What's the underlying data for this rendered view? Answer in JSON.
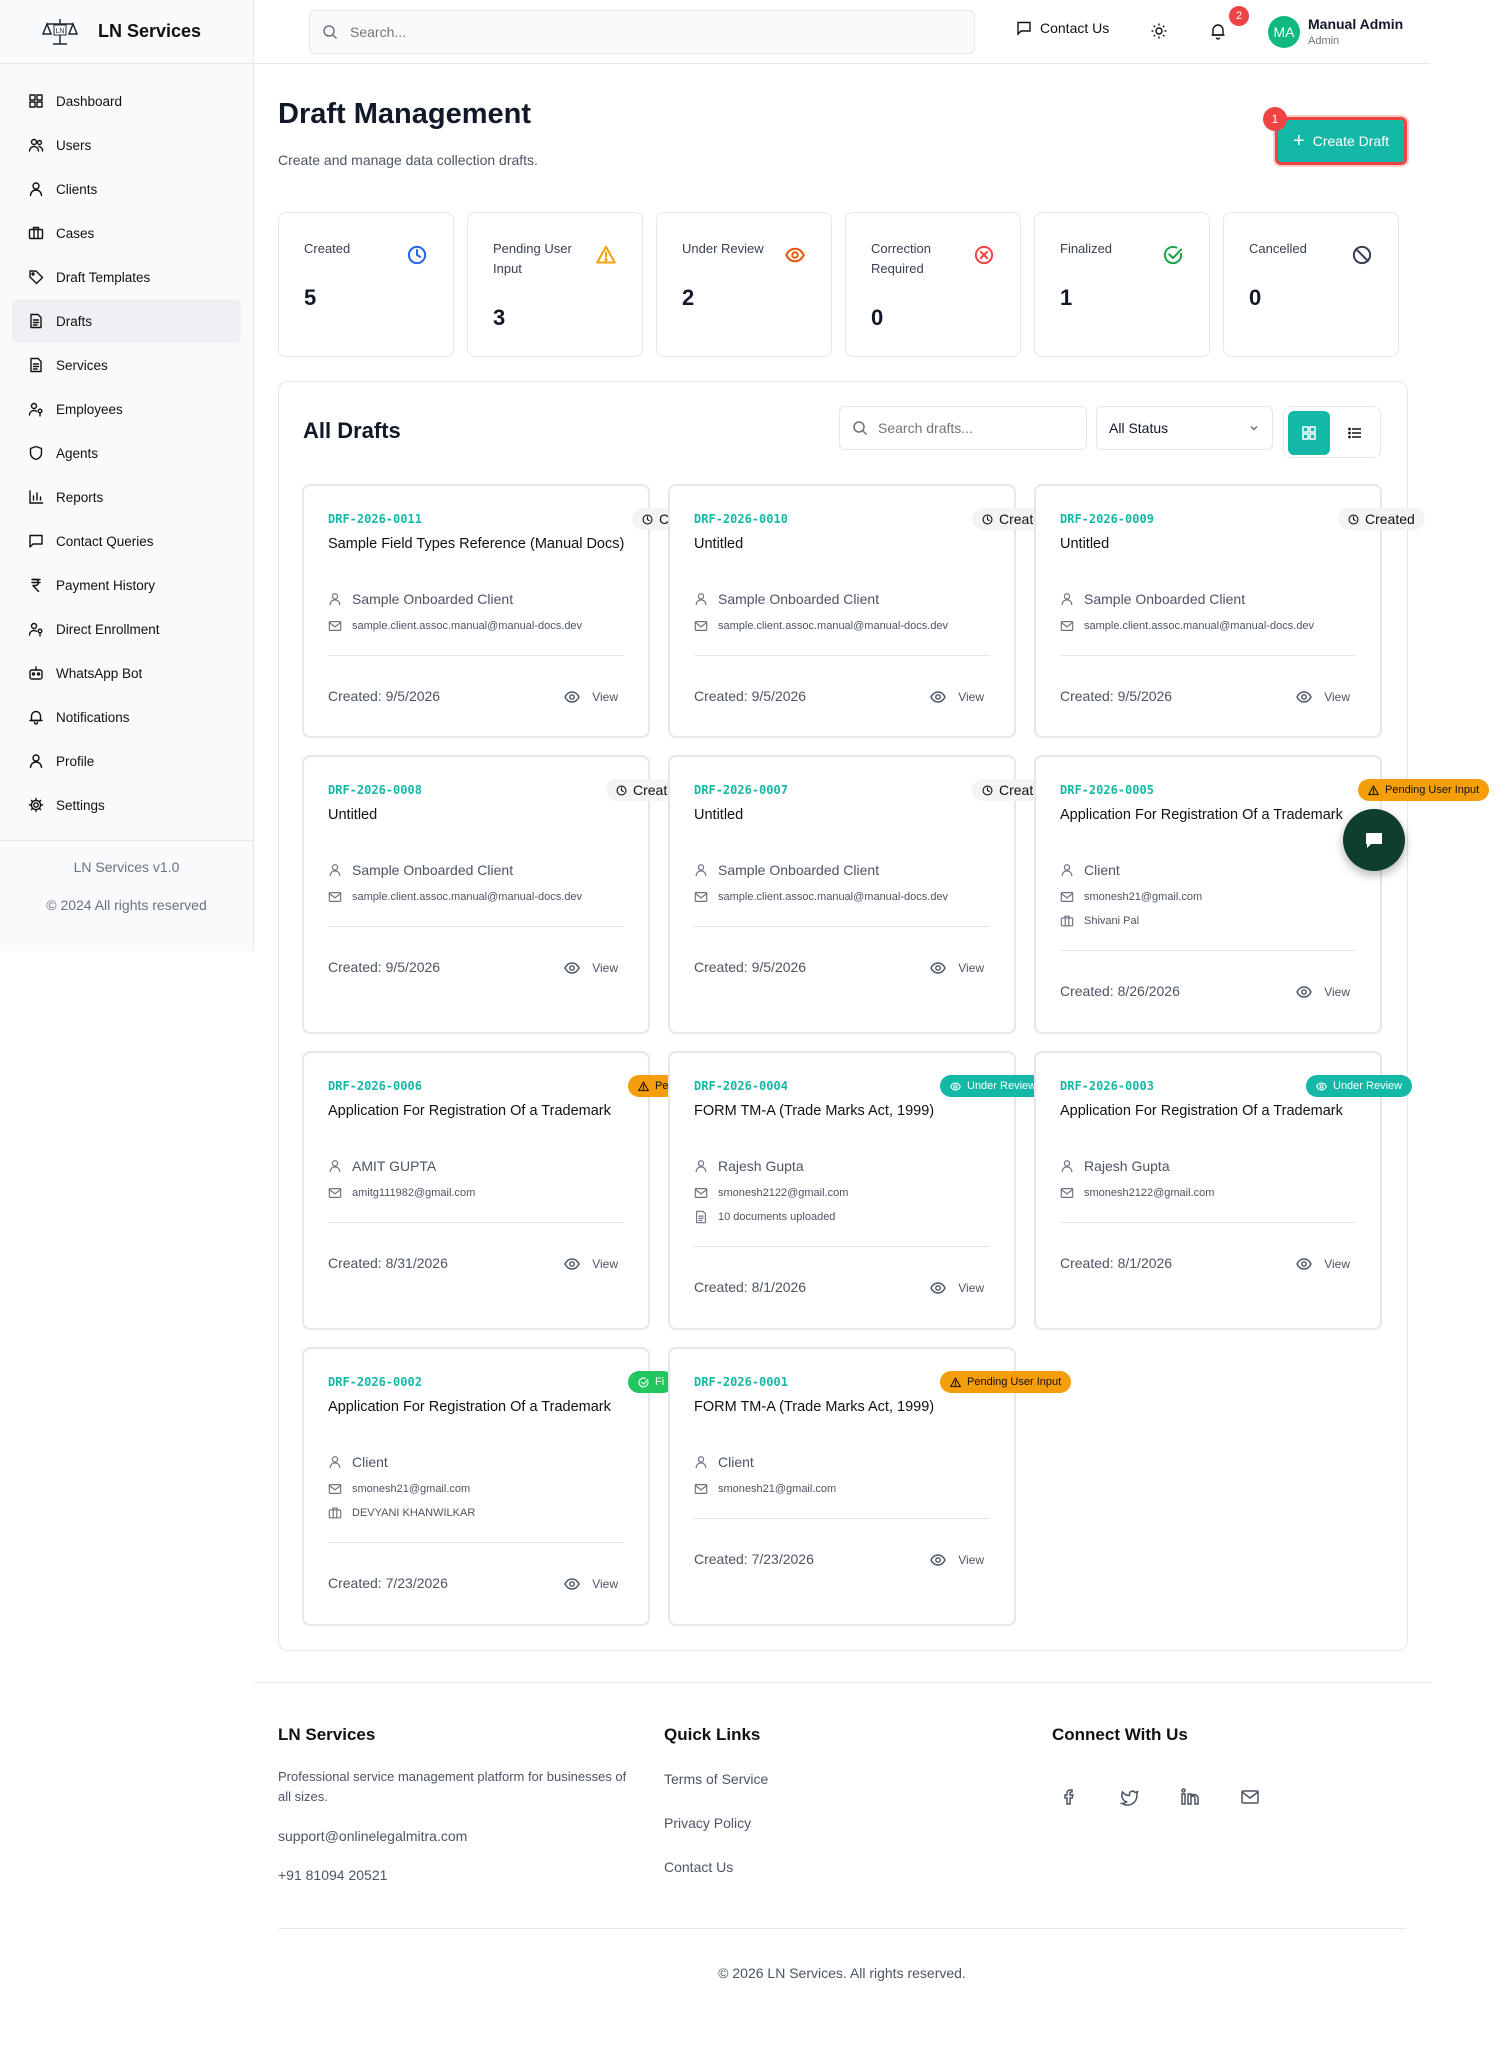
{
  "brand": {
    "name": "LN Services",
    "logo_text": "LN"
  },
  "sidebar": {
    "items": [
      {
        "label": "Dashboard",
        "icon": "dashboard-icon"
      },
      {
        "label": "Users",
        "icon": "users-icon"
      },
      {
        "label": "Clients",
        "icon": "user-icon"
      },
      {
        "label": "Cases",
        "icon": "briefcase-icon"
      },
      {
        "label": "Draft Templates",
        "icon": "tag-icon"
      },
      {
        "label": "Drafts",
        "icon": "file-icon",
        "active": true
      },
      {
        "label": "Services",
        "icon": "file-icon"
      },
      {
        "label": "Employees",
        "icon": "user-key-icon"
      },
      {
        "label": "Agents",
        "icon": "shield-icon"
      },
      {
        "label": "Reports",
        "icon": "chart-icon"
      },
      {
        "label": "Contact Queries",
        "icon": "message-icon"
      },
      {
        "label": "Payment History",
        "icon": "rupee-icon"
      },
      {
        "label": "Direct Enrollment",
        "icon": "user-key-icon"
      },
      {
        "label": "WhatsApp Bot",
        "icon": "bot-icon"
      },
      {
        "label": "Notifications",
        "icon": "bell-icon"
      },
      {
        "label": "Profile",
        "icon": "user-icon"
      },
      {
        "label": "Settings",
        "icon": "gear-icon"
      }
    ],
    "version": "LN Services v1.0",
    "rights": "© 2024 All rights reserved"
  },
  "header": {
    "search_placeholder": "Search...",
    "contact_label": "Contact Us",
    "notification_count": "2",
    "avatar_initials": "MA",
    "user_name": "Manual Admin",
    "user_role": "Admin"
  },
  "page": {
    "title": "Draft Management",
    "subtitle": "Create and manage data collection drafts.",
    "create_label": "Create Draft",
    "create_badge": "1"
  },
  "stats": [
    {
      "label": "Created",
      "value": "5",
      "icon": "clock-icon",
      "color": "#2563eb"
    },
    {
      "label": "Pending User Input",
      "value": "3",
      "icon": "warning-icon",
      "color": "#f59e0b"
    },
    {
      "label": "Under Review",
      "value": "2",
      "icon": "eye-icon",
      "color": "#ea580c"
    },
    {
      "label": "Correction Required",
      "value": "0",
      "icon": "x-circle-icon",
      "color": "#ef4444"
    },
    {
      "label": "Finalized",
      "value": "1",
      "icon": "check-circle-icon",
      "color": "#16a34a"
    },
    {
      "label": "Cancelled",
      "value": "0",
      "icon": "ban-icon",
      "color": "#374151"
    }
  ],
  "drafts_panel": {
    "title": "All Drafts",
    "search_placeholder": "Search drafts...",
    "status_filter": "All Status"
  },
  "drafts": [
    {
      "id": "DRF-2026-0011",
      "title": "Sample Field Types Reference (Manual Docs)",
      "status": "Created",
      "status_type": "created",
      "client": "Sample Onboarded Client",
      "email": "sample.client.assoc.manual@manual-docs.dev",
      "created": "Created: 9/5/2026",
      "view": "View"
    },
    {
      "id": "DRF-2026-0010",
      "title": "Untitled",
      "status": "Created",
      "status_type": "created",
      "client": "Sample Onboarded Client",
      "email": "sample.client.assoc.manual@manual-docs.dev",
      "created": "Created: 9/5/2026",
      "view": "View"
    },
    {
      "id": "DRF-2026-0009",
      "title": "Untitled",
      "status": "Created",
      "status_type": "created",
      "client": "Sample Onboarded Client",
      "email": "sample.client.assoc.manual@manual-docs.dev",
      "created": "Created: 9/5/2026",
      "view": "View"
    },
    {
      "id": "DRF-2026-0008",
      "title": "Untitled",
      "status": "Created",
      "status_type": "created",
      "client": "Sample Onboarded Client",
      "email": "sample.client.assoc.manual@manual-docs.dev",
      "created": "Created: 9/5/2026",
      "view": "View"
    },
    {
      "id": "DRF-2026-0007",
      "title": "Untitled",
      "status": "Created",
      "status_type": "created",
      "client": "Sample Onboarded Client",
      "email": "sample.client.assoc.manual@manual-docs.dev",
      "created": "Created: 9/5/2026",
      "view": "View"
    },
    {
      "id": "DRF-2026-0005",
      "title": "Application For Registration Of a Trademark",
      "status": "Pending User Input",
      "status_type": "pending",
      "client": "Client",
      "email": "smonesh21@gmail.com",
      "extra": "Shivani Pal",
      "extra_icon": "briefcase-icon",
      "created": "Created: 8/26/2026",
      "view": "View"
    },
    {
      "id": "DRF-2026-0006",
      "title": "Application For Registration Of a Trademark",
      "status": "Pe",
      "status_type": "pending",
      "client": "AMIT GUPTA",
      "email": "amitg111982@gmail.com",
      "created": "Created: 8/31/2026",
      "view": "View"
    },
    {
      "id": "DRF-2026-0004",
      "title": "FORM TM-A (Trade Marks Act, 1999)",
      "status": "Under Review",
      "status_type": "review",
      "client": "Rajesh Gupta",
      "email": "smonesh2122@gmail.com",
      "extra": "10 documents uploaded",
      "extra_icon": "document-icon",
      "created": "Created: 8/1/2026",
      "view": "View"
    },
    {
      "id": "DRF-2026-0003",
      "title": "Application For Registration Of a Trademark",
      "status": "Under Review",
      "status_type": "review",
      "client": "Rajesh Gupta",
      "email": "smonesh2122@gmail.com",
      "created": "Created: 8/1/2026",
      "view": "View"
    },
    {
      "id": "DRF-2026-0002",
      "title": "Application For Registration Of a Trademark",
      "status": "Fi",
      "status_type": "final",
      "client": "Client",
      "email": "smonesh21@gmail.com",
      "extra": "DEVYANI KHANWILKAR",
      "extra_icon": "briefcase-icon",
      "created": "Created: 7/23/2026",
      "view": "View"
    },
    {
      "id": "DRF-2026-0001",
      "title": "FORM TM-A (Trade Marks Act, 1999)",
      "status": "Pending User Input",
      "status_type": "pending",
      "client": "Client",
      "email": "smonesh21@gmail.com",
      "created": "Created: 7/23/2026",
      "view": "View"
    }
  ],
  "footer": {
    "brand_title": "LN Services",
    "brand_desc": "Professional service management platform for businesses of all sizes.",
    "email": "support@onlinelegalmitra.com",
    "phone": "+91 81094 20521",
    "links_title": "Quick Links",
    "links": [
      "Terms of Service",
      "Privacy Policy",
      "Contact Us"
    ],
    "connect_title": "Connect With Us",
    "social": [
      "facebook-icon",
      "twitter-icon",
      "linkedin-icon",
      "mail-icon"
    ],
    "copyright": "© 2026 LN Services. All rights reserved."
  },
  "colors": {
    "accent": "#14b8a6",
    "danger": "#ef4444",
    "pending": "#f59e0b"
  }
}
